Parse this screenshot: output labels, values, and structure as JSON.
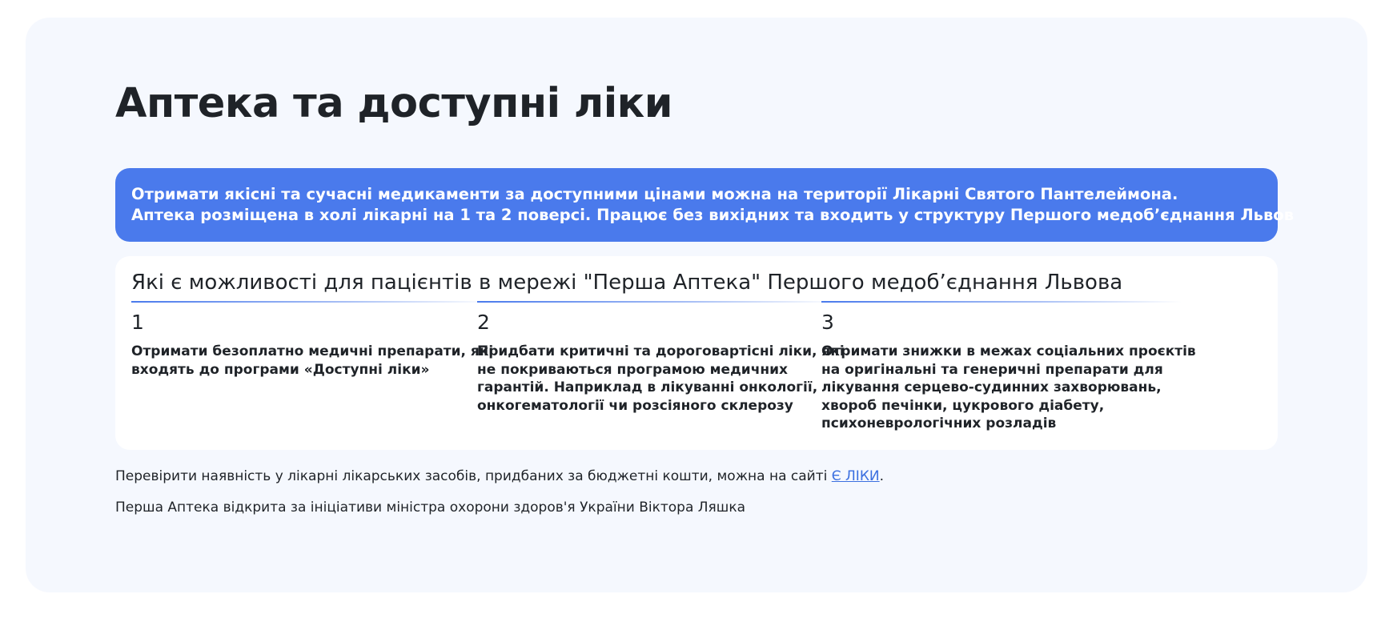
{
  "page": {
    "title": "Аптека та доступні ліки"
  },
  "banner": {
    "line1": "Отримати якісні та сучасні медикаменти за доступними цінами можна на території Лікарні Святого Пантелеймона.",
    "line2": "Аптека розміщена в холі лікарні на 1 та 2 поверсі. Працює без вихідних та входить у структуру Першого медоб’єднання Львов",
    "color": "#4a7aec"
  },
  "features": {
    "title": "Які є можливості для пацієнтів в мережі \"Перша Аптека\" Першого медоб’єднання Львова",
    "items": [
      {
        "number": "1",
        "text": "Отримати безоплатно медичні препарати, які входять до програми «Доступні ліки»"
      },
      {
        "number": "2",
        "text": "Придбати критичні та дороговартісні ліки, які не покриваються програмою медичних гарантій. Наприклад в лікуванні онкології, онкогематології чи розсіяного склерозу"
      },
      {
        "number": "3",
        "text": "Отримати знижки в межах соціальних проєктів на оригінальні та генеричні препарати для лікування серцево-судинних захворювань, хвороб печінки, цукрового діабету, психоневрологічних розладів"
      }
    ]
  },
  "notes": {
    "availability_prefix": "Перевірити наявність у лікарні лікарських засобів, придбаних за бюджетні кошти, можна на сайті ",
    "availability_link": "Є ЛІКИ",
    "availability_suffix": ".",
    "initiative": "Перша Аптека відкрита за ініціативи міністра охорони здоров'я України Віктора Ляшка"
  },
  "colors": {
    "accent": "#4a7aec",
    "page_background": "#f5f8fe",
    "link": "#3b6fe0"
  }
}
